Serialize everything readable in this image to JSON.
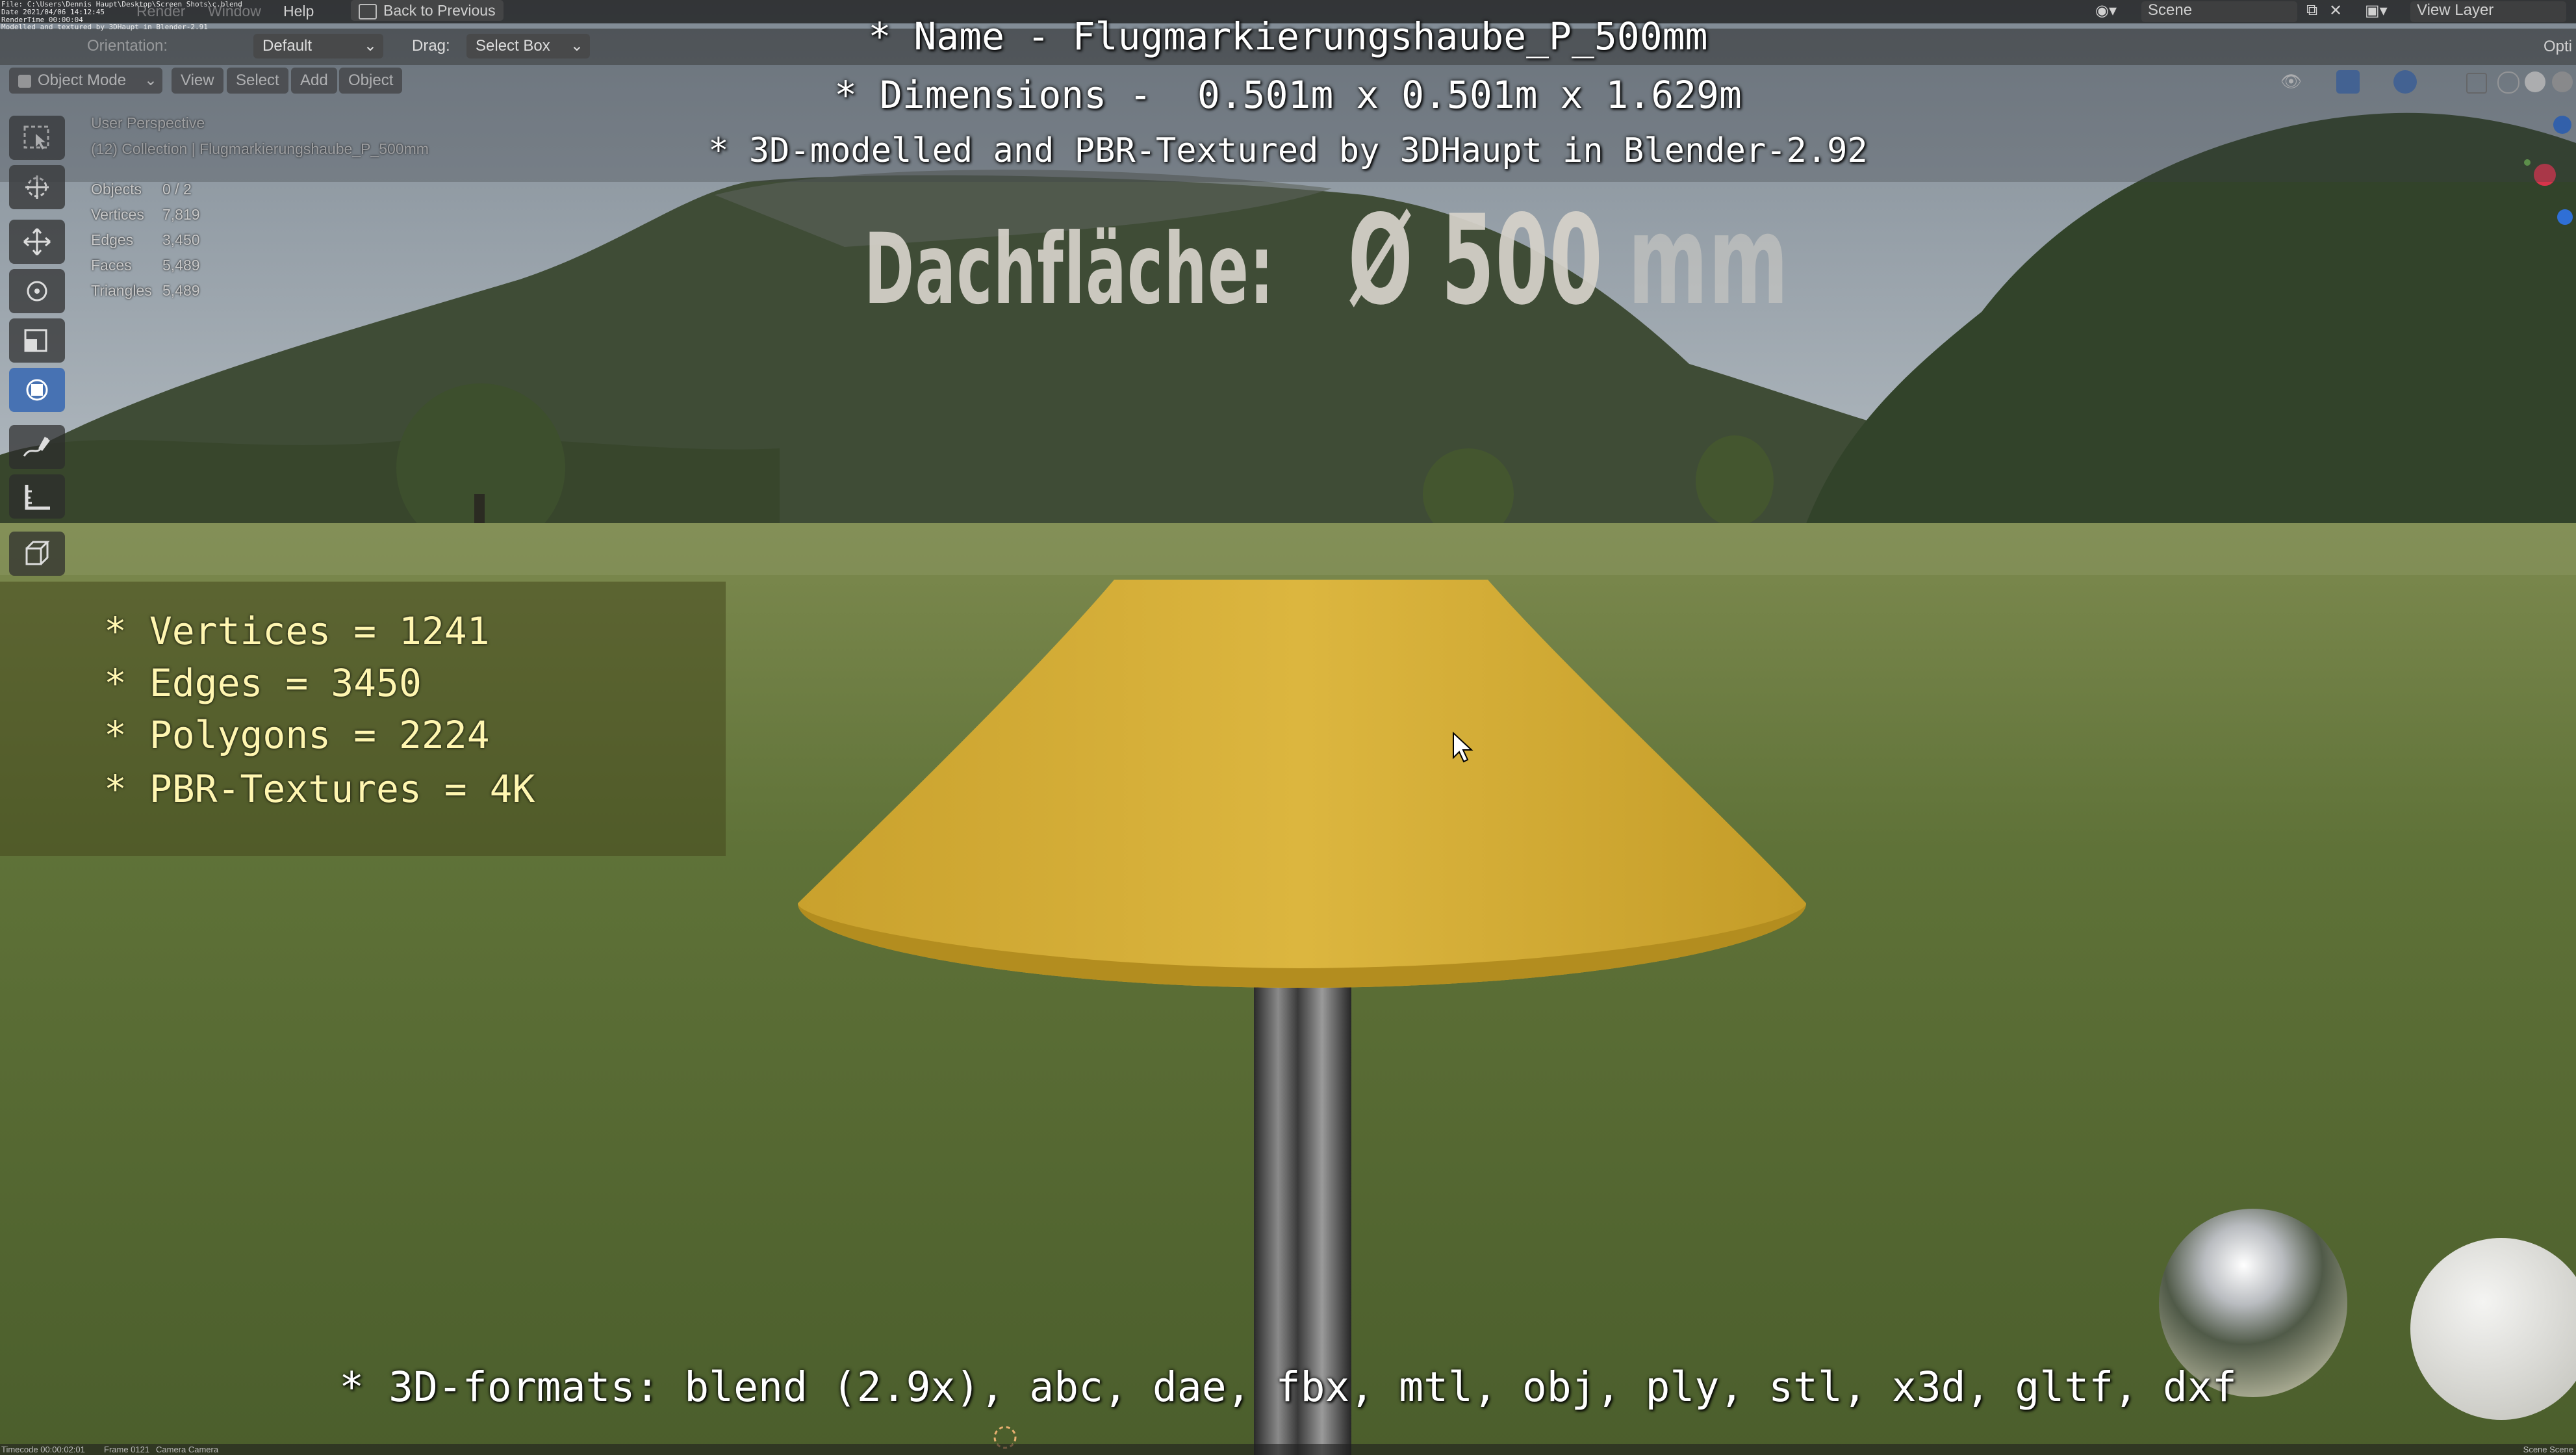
{
  "app": {
    "top_menu": [
      "Help",
      "Back to Previous"
    ],
    "faded_menu": [
      "Render",
      "Window"
    ],
    "render_info_lines": [
      "File: C:\\Users\\Dennis Haupt\\Desktop\\Screen Shots\\c.blend",
      "Date 2021/04/06 14:12:45",
      "RenderTime 00:00:04",
      "Modelled and textured by 3DHaupt in Blender-2.91"
    ],
    "scene_label": "Scene",
    "view_layer_label": "View Layer",
    "options_label": "Opti"
  },
  "header": {
    "orientation_label": "Orientation:",
    "orientation_value": "Default",
    "drag_label": "Drag:",
    "drag_value": "Select Box"
  },
  "viewport_header": {
    "mode": "Object Mode",
    "menus": [
      "View",
      "Select",
      "Add",
      "Object"
    ]
  },
  "overlay": {
    "perspective": "User Perspective",
    "collection": "(12) Collection | Flugmarkierungshaube_P_500mm",
    "stats": [
      {
        "label": "Objects",
        "value": "0 / 2"
      },
      {
        "label": "Vertices",
        "value": "7,819"
      },
      {
        "label": "Edges",
        "value": "3,450"
      },
      {
        "label": "Faces",
        "value": "5,489"
      },
      {
        "label": "Triangles",
        "value": "5,489"
      }
    ]
  },
  "title_lines": [
    "* Name - Flugmarkierungshaube_P_500mm",
    "* Dimensions -  0.501m x 0.501m x 1.629m",
    "* 3D-modelled and PBR-Textured by 3DHaupt in Blender-2.92"
  ],
  "scene_text": {
    "dachflaeche_label": "Dachfläche:",
    "diameter": "Ø 500",
    "unit": "mm"
  },
  "info_box": [
    "* Vertices = 1241",
    "* Edges = 3450",
    "* Polygons = 2224",
    "* PBR-Textures = 4K"
  ],
  "formats_line": "* 3D-formats: blend (2.9x), abc, dae, fbx, mtl, obj, ply, stl, x3d, gltf, dxf",
  "status_bar": {
    "timecode": "Timecode 00:00:02:01",
    "frame": "Frame 0121",
    "camera": "Camera Camera",
    "scene_right": "Scene Scene"
  },
  "tools": [
    "select-box-icon",
    "cursor-icon",
    "move-icon",
    "rotate-icon",
    "scale-icon",
    "transform-icon",
    "annotate-icon",
    "measure-icon",
    "add-cube-icon"
  ],
  "colors": {
    "accent": "#4772b3",
    "lampshade": "#d8b23a",
    "info_text": "#fff6b0"
  }
}
